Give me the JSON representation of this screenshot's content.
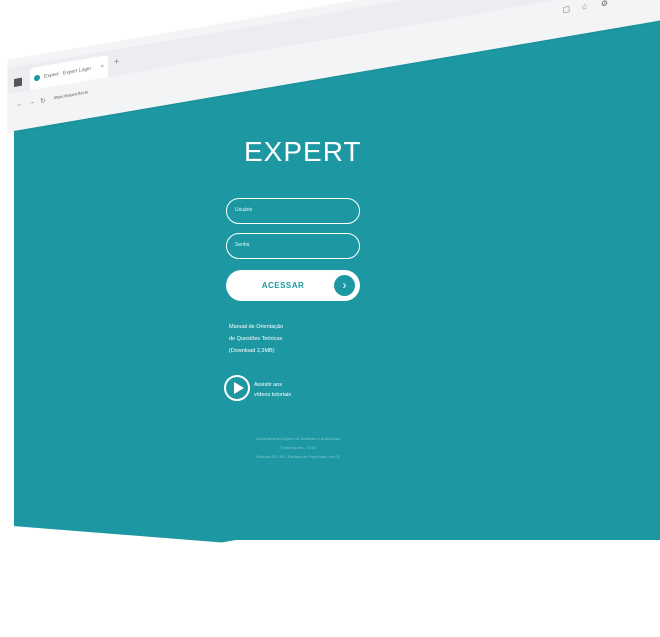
{
  "browser": {
    "tab_title": "Expert · Expert Login",
    "tab_close": "×",
    "new_tab": "+",
    "url": "https://expert.flsv.br",
    "window_min": "–",
    "window_max": "▫",
    "window_close": "×"
  },
  "login": {
    "logo": "EXPERT",
    "user_placeholder": "Usuário",
    "password_placeholder": "Senha",
    "submit_label": "ACESSAR",
    "submit_icon": "chevron-right-icon"
  },
  "links": {
    "manual_line1": "Manual de Orientação",
    "manual_line2": "de Questões Teóricas",
    "manual_line3": "(Download 2,3MB)",
    "video_line1": "Assistir aos",
    "video_line2": "vídeos tutoriais"
  },
  "footer": {
    "line1": "Departamento Expert de Software e Aplicações",
    "line2": "Florianópolis - 2015",
    "line3": "Rodovia SC-401, Estrada de Porto Belo, km 02"
  },
  "colors": {
    "brand": "#1d98a3"
  }
}
